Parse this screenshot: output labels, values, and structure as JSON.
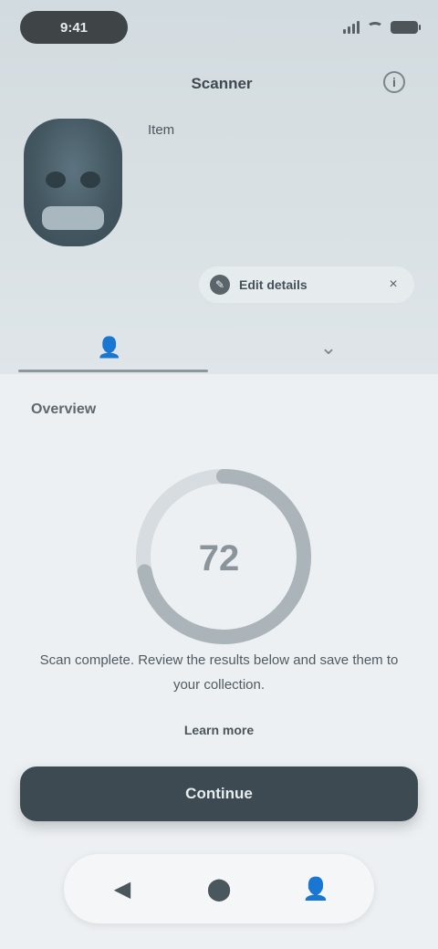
{
  "status_bar": {
    "time": "9:41",
    "icons": [
      "signal-icon",
      "wifi-icon",
      "battery-icon"
    ]
  },
  "header": {
    "app_name": "Scanner",
    "info_icon_glyph": "i"
  },
  "item": {
    "thumbnail_icon": "skull-thumbnail",
    "label": "Item"
  },
  "action_chip": {
    "icon_glyph": "✎",
    "label": "Edit details",
    "close_glyph": "×"
  },
  "tabs": [
    {
      "icon": "person-icon",
      "glyph": "👤",
      "active": true
    },
    {
      "icon": "filter-icon",
      "glyph": "⌄",
      "active": false
    }
  ],
  "section": {
    "title": "Overview"
  },
  "ring": {
    "value": "72",
    "progress_percent": 72,
    "track_color": "#d6dcdf",
    "fill_color": "#aab4b9"
  },
  "description": "Scan complete. Review the results below and save them to your collection.",
  "link_label": "Learn more",
  "primary_button": {
    "label": "Continue"
  },
  "bottom_nav": [
    {
      "icon": "back-icon",
      "glyph": "◀"
    },
    {
      "icon": "home-icon",
      "glyph": "⬤"
    },
    {
      "icon": "profile-icon",
      "glyph": "👤"
    }
  ],
  "colors": {
    "hero_background": "#d2dbdf",
    "panel_background": "#edf0f2",
    "primary": "#3d4a52"
  }
}
